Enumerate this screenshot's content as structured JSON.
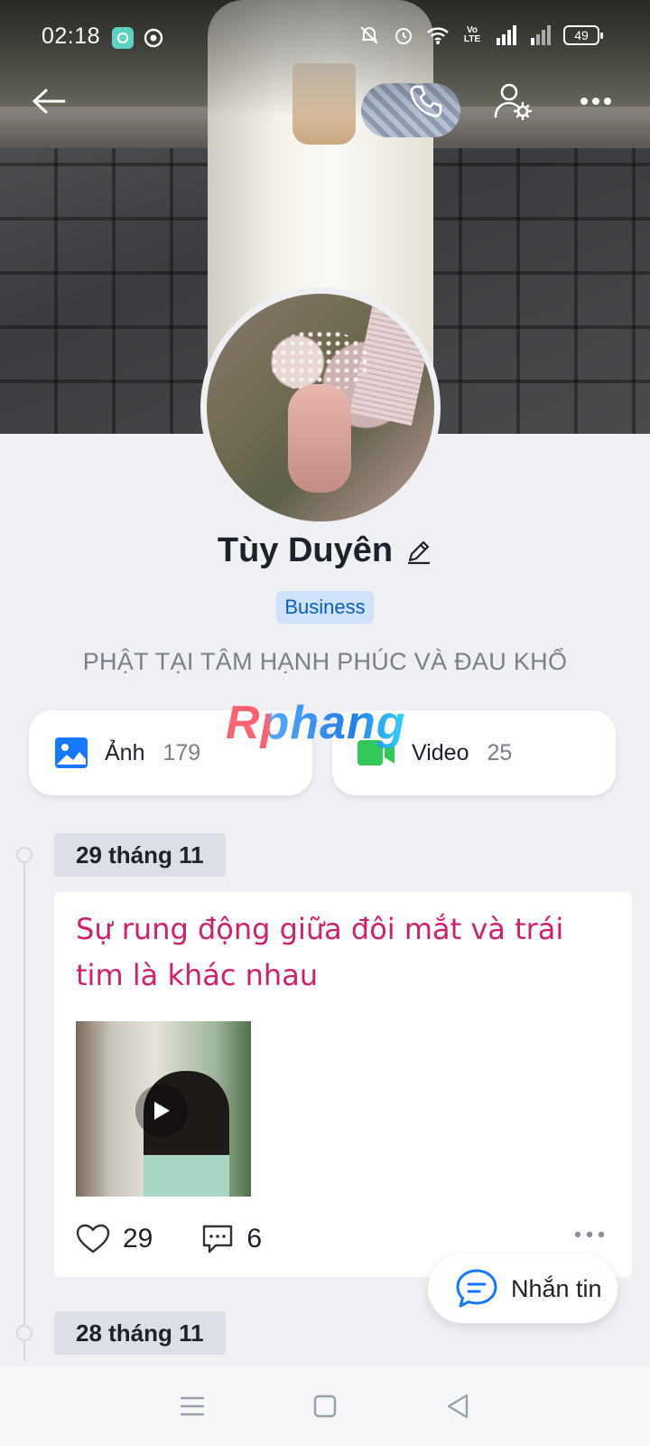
{
  "status_bar": {
    "time": "02:18",
    "battery": "49",
    "icons": [
      "app-notification-icon",
      "vpn-icon",
      "silent-icon",
      "alarm-icon",
      "wifi-icon",
      "volte-icon",
      "signal-icon",
      "signal-2-icon",
      "battery-icon"
    ]
  },
  "top_nav": {
    "back_icon": "back-arrow-icon",
    "call_icon": "phone-icon",
    "settings_icon": "user-settings-icon",
    "more_icon": "more-horizontal-icon"
  },
  "profile": {
    "name": "Tùy Duyên",
    "badge": "Business",
    "bio": "PHẬT TẠI TÂM HẠNH PHÚC VÀ ĐAU KHỔ",
    "edit_icon": "pencil-icon"
  },
  "media": {
    "photos": {
      "label": "Ảnh",
      "count": "179",
      "icon": "image-icon"
    },
    "videos": {
      "label": "Video",
      "count": "25",
      "icon": "video-icon"
    }
  },
  "watermark": "Rphang",
  "timeline": {
    "groups": [
      {
        "date": "29 tháng 11",
        "post": {
          "text": "Sự rung động giữa đôi mắt và trái tim là khác nhau",
          "likes": "29",
          "comments": "6"
        }
      },
      {
        "date": "28 tháng 11"
      }
    ]
  },
  "chat_button": {
    "label": "Nhắn tin",
    "icon": "chat-bubble-icon"
  },
  "system_nav": [
    "menu-icon",
    "home-square-icon",
    "back-triangle-icon"
  ],
  "colors": {
    "accent": "#0068ff",
    "post_text": "#d11f6f",
    "badge_bg": "#cfe2fb",
    "badge_text": "#0b5bc4",
    "video_green": "#34c759"
  }
}
